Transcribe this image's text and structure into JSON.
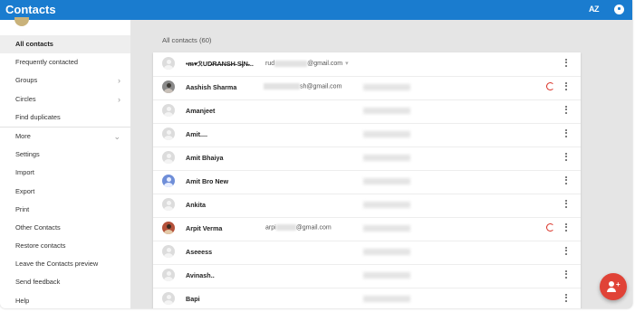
{
  "app": {
    "title": "Contacts",
    "sort_label": "AZ",
    "sort_icon": "sort-az-icon",
    "chat_icon": "hangouts-icon"
  },
  "colors": {
    "topbar": "#1a7ccf",
    "fab": "#e04337",
    "circles_badge": "#d93025"
  },
  "sidebar": {
    "items": [
      {
        "label": "All contacts",
        "active": true,
        "chevron": false
      },
      {
        "label": "Frequently contacted",
        "chevron": false
      },
      {
        "label": "Groups",
        "chevron": true
      },
      {
        "label": "Circles",
        "chevron": true
      },
      {
        "label": "Find duplicates",
        "chevron": false
      },
      {
        "label": "More",
        "chevron": true
      },
      {
        "label": "Settings",
        "chevron": false
      },
      {
        "label": "Import",
        "chevron": false
      },
      {
        "label": "Export",
        "chevron": false
      },
      {
        "label": "Print",
        "chevron": false
      },
      {
        "label": "Other Contacts",
        "chevron": false
      },
      {
        "label": "Restore contacts",
        "chevron": false
      },
      {
        "label": "Leave the Contacts preview",
        "chevron": false
      },
      {
        "label": "Send feedback",
        "chevron": false
      },
      {
        "label": "Help",
        "chevron": false
      }
    ]
  },
  "main": {
    "heading": "All contacts (60)",
    "contacts": [
      {
        "name": "•ᵯ♥ℛUD̶R̶A̶N̶S̶H̶ S̶ᶅN̶...",
        "email_prefix": "rud",
        "email_suffix": "@gmail.com",
        "email_caret": "▾",
        "avatar": "default"
      },
      {
        "name": "Aashish Sharma",
        "email_prefix": "",
        "email_suffix": "sh@gmail.com",
        "avatar": "photo1",
        "circles": true
      },
      {
        "name": "Amanjeet",
        "avatar": "default"
      },
      {
        "name": "Amit....",
        "avatar": "default"
      },
      {
        "name": "Amit Bhaiya",
        "avatar": "default"
      },
      {
        "name": "Amit Bro New",
        "avatar": "blue"
      },
      {
        "name": "Ankita",
        "avatar": "default"
      },
      {
        "name": "Arpit Verma",
        "email_prefix": "arpi",
        "email_suffix": "@gmail.com",
        "avatar": "photo2",
        "circles": true
      },
      {
        "name": "Aseeess",
        "avatar": "default"
      },
      {
        "name": "Avinash..",
        "avatar": "default"
      },
      {
        "name": "Bapi",
        "avatar": "default"
      }
    ]
  },
  "fab": {
    "icon": "add-person-icon"
  }
}
